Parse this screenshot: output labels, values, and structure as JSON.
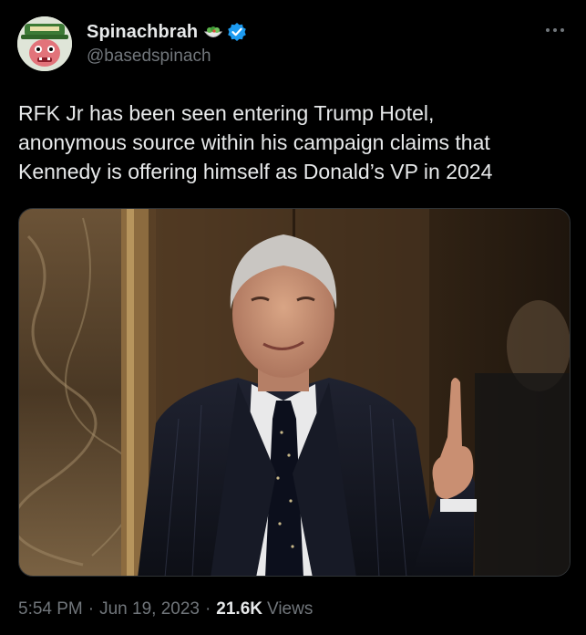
{
  "author": {
    "display_name": "Spinachbrah",
    "handle": "@basedspinach",
    "verified": true,
    "name_emoji": "salad-bowl-emoji",
    "avatar": "cartoon-avatar-green-hat",
    "verified_color": "#1d9bf0"
  },
  "tweet": {
    "text": "RFK Jr has been seen entering Trump Hotel,\nanonymous source within his campaign claims that\nKennedy is offering himself as Donald’s VP in 2024",
    "media": {
      "type": "photo",
      "subject": "man-in-suit-pointing-finger-up",
      "background": "marble-elevator-lobby"
    }
  },
  "meta": {
    "time": "5:54 PM",
    "date": "Jun 19, 2023",
    "separator": "·",
    "views_count": "21.6K",
    "views_label": "Views"
  },
  "icons": {
    "more": "more-options-icon",
    "verified": "verified-badge-icon"
  },
  "colors": {
    "background": "#000000",
    "text_primary": "#e7e9ea",
    "text_secondary": "#71767b",
    "accent": "#1d9bf0"
  }
}
